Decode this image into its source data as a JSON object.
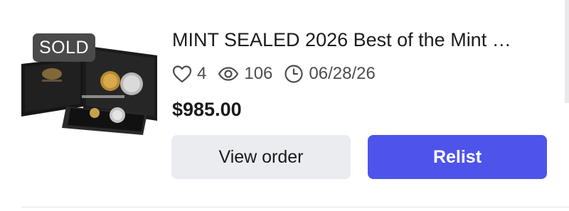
{
  "listing": {
    "status_badge": "SOLD",
    "title": "MINT SEALED 2026 Best of the Mint …",
    "stats": {
      "likes": "4",
      "views": "106",
      "date": "06/28/26"
    },
    "price": "$985.00",
    "icons": {
      "likes": "heart-icon",
      "views": "eye-icon",
      "date": "clock-icon"
    }
  },
  "actions": {
    "view_order_label": "View order",
    "relist_label": "Relist"
  },
  "colors": {
    "primary": "#4e53ea",
    "secondary_button": "#ebecf0",
    "badge": "#4a4a4a"
  }
}
